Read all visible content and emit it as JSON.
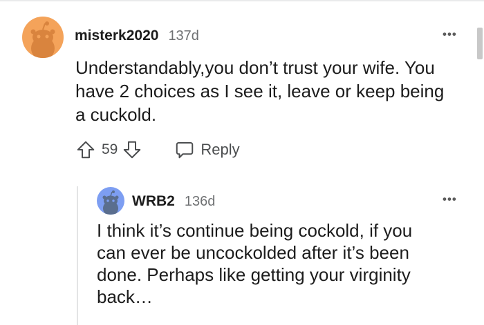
{
  "comments": [
    {
      "username": "misterk2020",
      "age": "137d",
      "text_lines": [
        "Understandably,you don’t trust your wife. You",
        "have 2 choices as I see it, leave or keep being",
        "a cuckold."
      ],
      "votes": "59",
      "reply_label": "Reply",
      "avatar_color": "#f4a35a"
    },
    {
      "username": "WRB2",
      "age": "136d",
      "text_lines": [
        "I think it’s continue being cockold, if you",
        "can ever be uncockolded after it’s been",
        "done. Perhaps like getting your virginity",
        "back…"
      ],
      "avatar_color": "#7d9ef2"
    }
  ],
  "overflow_menu_label": "•••"
}
